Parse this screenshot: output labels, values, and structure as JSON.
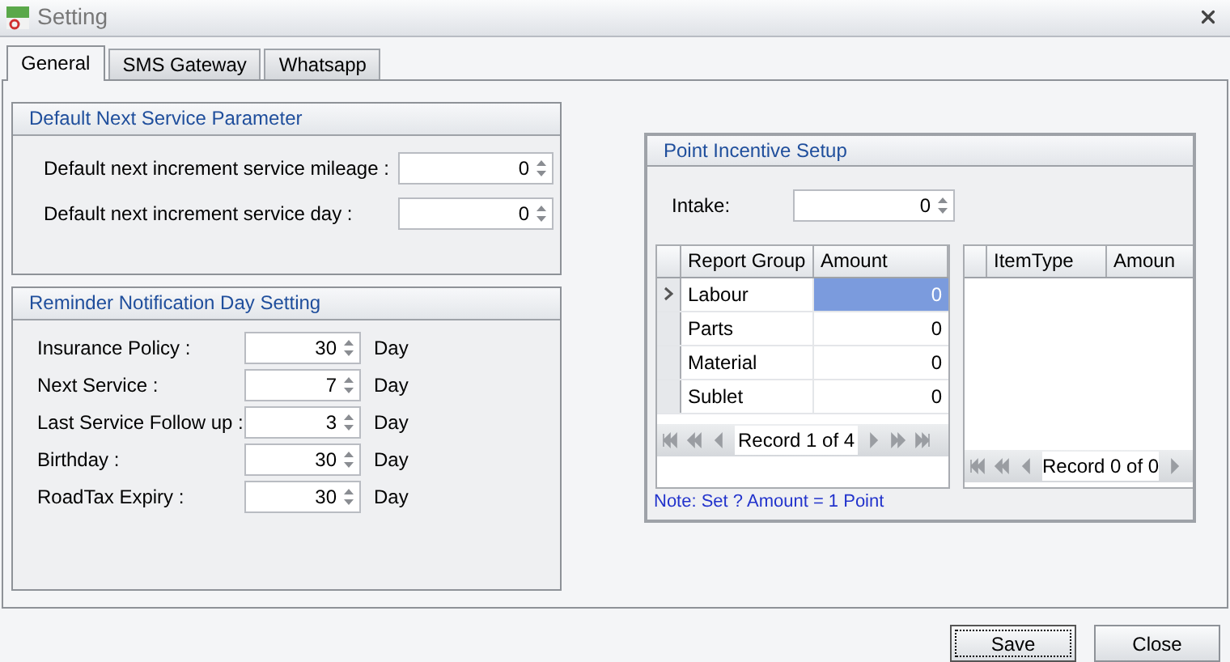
{
  "window": {
    "title": "Setting"
  },
  "tabs": [
    {
      "label": "General",
      "selected": true
    },
    {
      "label": "SMS Gateway",
      "selected": false
    },
    {
      "label": "Whatsapp",
      "selected": false
    }
  ],
  "default_next_service": {
    "title": "Default Next Service Parameter",
    "fields": [
      {
        "label": "Default next increment service mileage :",
        "value": "0"
      },
      {
        "label": "Default next increment service day :",
        "value": "0"
      }
    ]
  },
  "reminder": {
    "title": "Reminder Notification Day Setting",
    "fields": [
      {
        "label": "Insurance Policy :",
        "value": "30",
        "unit": "Day"
      },
      {
        "label": "Next Service :",
        "value": "7",
        "unit": "Day"
      },
      {
        "label": "Last Service Follow up :",
        "value": "3",
        "unit": "Day"
      },
      {
        "label": "Birthday :",
        "value": "30",
        "unit": "Day"
      },
      {
        "label": "RoadTax Expiry :",
        "value": "30",
        "unit": "Day"
      }
    ]
  },
  "point_incentive": {
    "title": "Point Incentive Setup",
    "intake": {
      "label": "Intake:",
      "value": "0"
    },
    "report_grid": {
      "columns": [
        "Report Group",
        "Amount"
      ],
      "rows": [
        {
          "cells": [
            "Labour",
            "0"
          ],
          "selected": true
        },
        {
          "cells": [
            "Parts",
            "0"
          ],
          "selected": false
        },
        {
          "cells": [
            "Material",
            "0"
          ],
          "selected": false
        },
        {
          "cells": [
            "Sublet",
            "0"
          ],
          "selected": false
        }
      ],
      "navigator": "Record 1 of 4"
    },
    "item_grid": {
      "columns": [
        "ItemType",
        "Amoun"
      ],
      "navigator": "Record 0 of 0"
    },
    "note": "Note: Set ? Amount = 1 Point"
  },
  "buttons": [
    {
      "label": "Save",
      "focused": true
    },
    {
      "label": "Close",
      "focused": false
    }
  ]
}
